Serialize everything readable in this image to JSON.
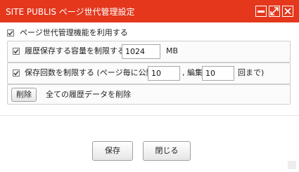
{
  "window": {
    "title": "SITE PUBLIS ページ世代管理設定",
    "controls": {
      "minimize": "minimize-icon",
      "maximize": "maximize-icon",
      "close": "close-icon"
    }
  },
  "settings": {
    "enable": {
      "checked": true,
      "label": "ページ世代管理機能を利用する"
    },
    "capacity": {
      "checked": true,
      "label": "履歴保存する容量を制限する",
      "value": "1024",
      "unit": "MB"
    },
    "count": {
      "checked": true,
      "label": "保存回数を制限する (ページ毎に公開",
      "publish_value": "10",
      "edit_label": ", 編集",
      "edit_value": "10",
      "suffix": "回まで)"
    },
    "delete": {
      "button_label": "削除",
      "description": "全ての履歴データを削除"
    }
  },
  "footer": {
    "save_label": "保存",
    "close_label": "閉じる"
  },
  "colors": {
    "titlebar": "#e4371c",
    "title_text": "#ffffff"
  }
}
